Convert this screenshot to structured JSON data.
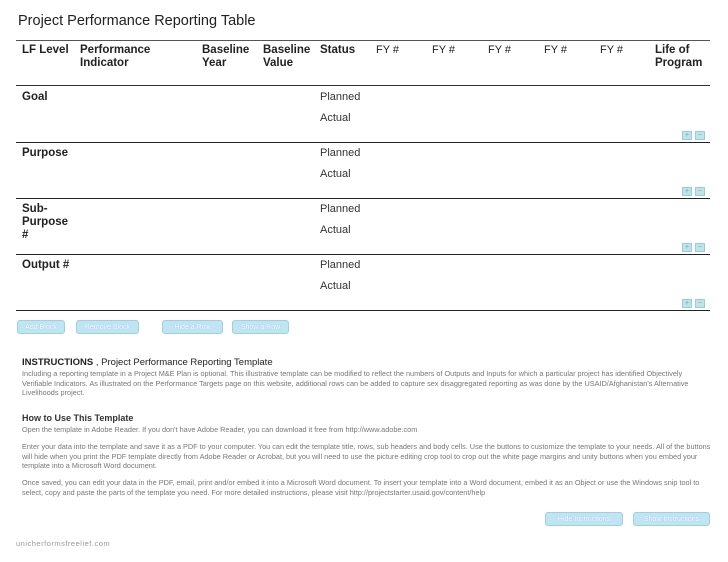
{
  "page": {
    "title": "Project Performance Reporting Table"
  },
  "table": {
    "headers": {
      "lf_level": "LF Level",
      "performance_indicator": "Performance Indicator",
      "baseline_year": "Baseline Year",
      "baseline_value": "Baseline Value",
      "status": "Status",
      "fy": [
        "FY #",
        "FY #",
        "FY #",
        "FY #",
        "FY #"
      ],
      "life_of_program": "Life of Program"
    },
    "rows": [
      {
        "level": "Goal",
        "planned": "Planned",
        "actual": "Actual"
      },
      {
        "level": "Purpose",
        "planned": "Planned",
        "actual": "Actual"
      },
      {
        "level": "Sub-Purpose #",
        "planned": "Planned",
        "actual": "Actual"
      },
      {
        "level": "Output #",
        "planned": "Planned",
        "actual": "Actual"
      }
    ],
    "row_icons": [
      "add-row-icon",
      "remove-row-icon"
    ]
  },
  "buttons": {
    "add_block": "Add Block",
    "remove_block": "Remove Block",
    "hide_row": "Hide a Row",
    "show_row": "Show a Row",
    "hide_instructions": "Hide Instructions",
    "show_instructions": "Show Instructions"
  },
  "instructions": {
    "heading_bold": "INSTRUCTIONS",
    "heading_rest": " , Project Performance Reporting Template",
    "intro": "Including a reporting template in a Project M&E Plan is optional. This illustrative template can be modified to reflect the numbers of Outputs and Inputs for which a particular project has identified Objectively Verifiable Indicators. As illustrated on the Performance Targets page on this website, additional rows can be added to capture sex disaggregated reporting as was done by the USAID/Afghanistan's Alternative Livelihoods project.",
    "how_to_title": "How to Use This Template",
    "step1": "Open the template in Adobe Reader. If you don't have Adobe Reader, you can download it free from http://www.adobe.com",
    "step2": "Enter your data into the template and save it as a PDF to your computer. You can edit the template title, rows, sub headers and body cells. Use the buttons to customize the template to your needs. All of the buttons will hide when you print the PDF template directly from Adobe Reader or Acrobat, but you will need to use the picture editing crop tool to crop out the white page margins and unity buttons when you embed your template into a Microsoft Word document.",
    "step3": "Once saved, you can edit your data in the PDF, email, print and/or embed it into a Microsoft Word document. To insert your template into a Word document, embed it as an Object or use the Windows snip tool to select, copy and paste the parts of the template you need. For more detailed instructions, please visit http://projectstarter.usaid.gov/content/help"
  },
  "footer": {
    "watermark": "unicherformsfreelief.com"
  }
}
